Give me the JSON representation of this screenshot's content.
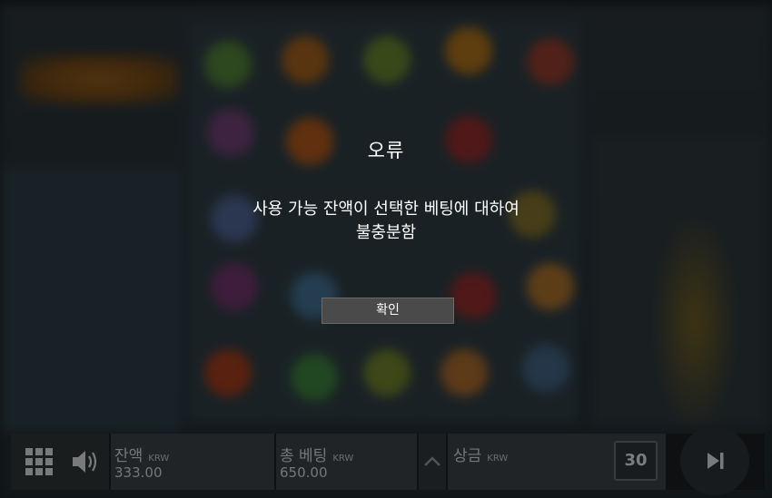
{
  "dialog": {
    "title": "오류",
    "message_line1": "사용 가능 잔액이 선택한 베팅에 대하여",
    "message_line2": "불충분함",
    "confirm_label": "확인"
  },
  "control_bar": {
    "balance": {
      "label": "잔액",
      "currency": "KRW",
      "value": "333.00"
    },
    "total_bet": {
      "label": "총 베팅",
      "currency": "KRW",
      "value": "650.00"
    },
    "win": {
      "label": "상금",
      "currency": "KRW"
    },
    "autoplay_count": "30",
    "icons": {
      "menu": "grid-menu-icon",
      "sound": "speaker-icon",
      "bet_toggle": "chevron-up-icon",
      "spin": "skip-forward-icon"
    }
  },
  "colors": {
    "overlay": "rgba(0,0,0,0.42)",
    "dialog_text": "#ffffff",
    "button_bg": "#4a4a4a"
  }
}
